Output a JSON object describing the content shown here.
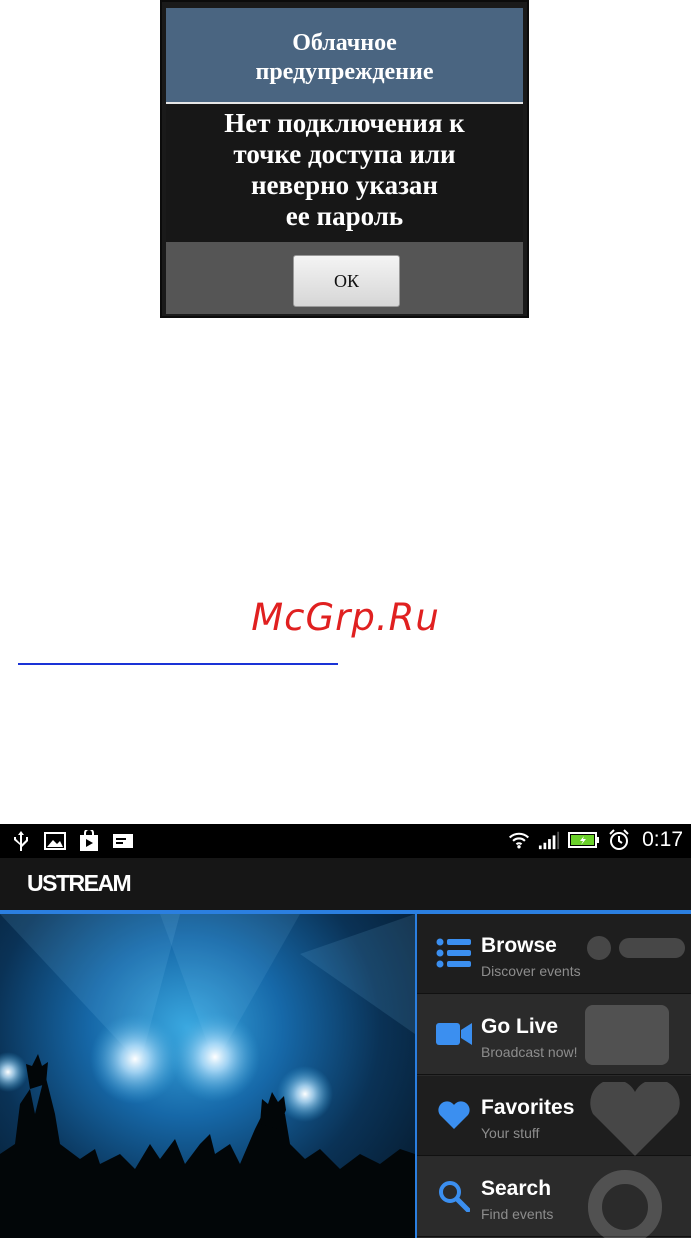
{
  "dialog": {
    "title": "Облачное\nпредупреждение",
    "message": "Нет подключения к\nточке доступа или\nневерно указан\nее пароль",
    "ok_label": "ОК"
  },
  "watermark": "McGrp.Ru",
  "phone": {
    "status": {
      "time": "0:17"
    },
    "app_title": "USTREAM",
    "menu": [
      {
        "label": "Browse",
        "sub": "Discover events",
        "icon": "list-icon"
      },
      {
        "label": "Go Live",
        "sub": "Broadcast now!",
        "icon": "video-camera-icon"
      },
      {
        "label": "Favorites",
        "sub": "Your stuff",
        "icon": "heart-icon"
      },
      {
        "label": "Search",
        "sub": "Find events",
        "icon": "search-icon"
      }
    ],
    "colors": {
      "accent": "#2b7fe0",
      "icon_blue": "#3b8ff0"
    }
  }
}
